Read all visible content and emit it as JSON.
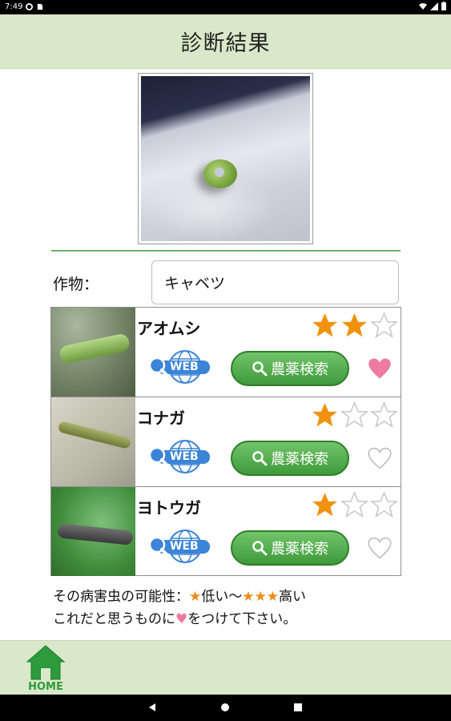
{
  "status_bar": {
    "time": "7:49"
  },
  "header": {
    "title": "診断結果"
  },
  "crop": {
    "label": "作物：",
    "value": "キャベツ"
  },
  "results": [
    {
      "name": "アオムシ",
      "rating": 2,
      "favorite": true,
      "web_label": "WEB",
      "pesticide_label": "農薬検索"
    },
    {
      "name": "コナガ",
      "rating": 1,
      "favorite": false,
      "web_label": "WEB",
      "pesticide_label": "農薬検索"
    },
    {
      "name": "ヨトウガ",
      "rating": 1,
      "favorite": false,
      "web_label": "WEB",
      "pesticide_label": "農薬検索"
    }
  ],
  "notes": {
    "line1_prefix": "その病害虫の可能性：",
    "line1_star_low": "★",
    "line1_low": "低い〜",
    "line1_star_high": "★★★",
    "line1_high": "高い",
    "line2_prefix": "これだと思うものに",
    "line2_heart": "♥",
    "line2_suffix": "をつけて下さい。"
  },
  "bottom_nav": {
    "home_label": "HOME"
  },
  "colors": {
    "accent_green": "#3f9a3a",
    "star_orange": "#f0920f",
    "heart_pink": "#ee7aa2",
    "bar_bg": "#d9e8c8"
  }
}
